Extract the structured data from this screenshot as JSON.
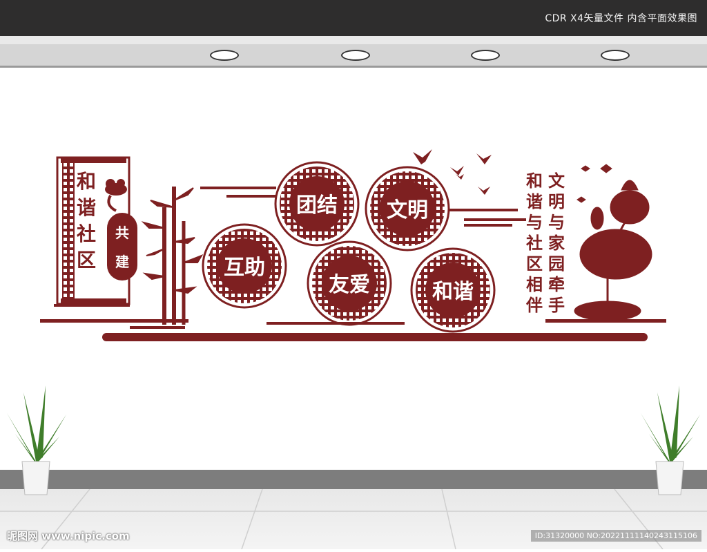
{
  "header": {
    "caption": "CDR X4矢量文件  内含平面效果图"
  },
  "wall_panel": {
    "vertical_title": [
      "和",
      "谐",
      "社",
      "区"
    ],
    "badge": {
      "top": "共",
      "bottom": "建"
    },
    "circles": [
      {
        "label": "团结"
      },
      {
        "label": "文明"
      },
      {
        "label": "互助"
      },
      {
        "label": "友爱"
      },
      {
        "label": "和谐"
      }
    ],
    "slogan_right_col": [
      "文",
      "明",
      "与",
      "家",
      "园",
      "牵",
      "手"
    ],
    "slogan_left_col": [
      "和",
      "谐",
      "与",
      "社",
      "区",
      "相",
      "伴"
    ]
  },
  "watermark": {
    "left": "昵图网 www.nipic.com",
    "right": "ID:31320000 NO:20221111140243115106"
  },
  "colors": {
    "accent": "#7e2021",
    "topbar": "#2e2d2d",
    "baseboard": "#7d7d7d"
  }
}
